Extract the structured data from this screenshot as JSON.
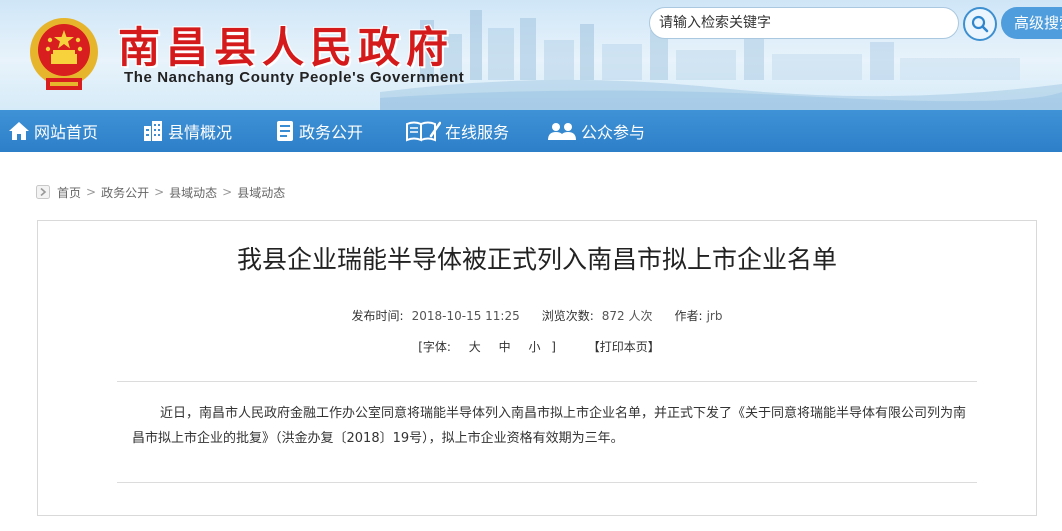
{
  "header": {
    "title": "南昌县人民政府",
    "subtitle": "The Nanchang County People's Government",
    "search_placeholder": "请输入检索关键字",
    "advanced_search": "高级搜索"
  },
  "nav": {
    "items": [
      {
        "label": "网站首页",
        "icon": "home-icon"
      },
      {
        "label": "县情概况",
        "icon": "building-icon"
      },
      {
        "label": "政务公开",
        "icon": "document-icon"
      },
      {
        "label": "在线服务",
        "icon": "book-pen-icon"
      },
      {
        "label": "公众参与",
        "icon": "people-icon"
      }
    ]
  },
  "breadcrumb": [
    "首页",
    "政务公开",
    "县域动态",
    "县域动态"
  ],
  "article": {
    "title": "我县企业瑞能半导体被正式列入南昌市拟上市企业名单",
    "publish_label": "发布时间:",
    "publish_time": "2018-10-15 11:25",
    "views_label": "浏览次数:",
    "views": "872 人次",
    "author_label": "作者:",
    "author": "jrb",
    "font_label": "[字体:",
    "font_large": "大",
    "font_medium": "中",
    "font_small": "小",
    "font_close": "]",
    "print_label": "【打印本页】",
    "body": "近日，南昌市人民政府金融工作办公室同意将瑞能半导体列入南昌市拟上市企业名单，并正式下发了《关于同意将瑞能半导体有限公司列为南昌市拟上市企业的批复》（洪金办复〔2018〕19号），拟上市企业资格有效期为三年。"
  },
  "colors": {
    "brand_red": "#d41a1a",
    "nav_blue": "#2d7fc8",
    "accent_blue": "#4f9ddc"
  }
}
